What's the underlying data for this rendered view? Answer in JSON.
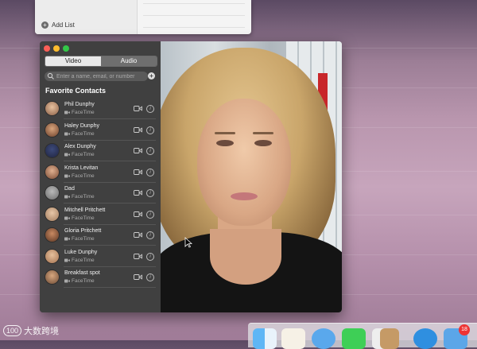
{
  "colors": {
    "close": "#fc5f57",
    "minimize": "#fdbc2e",
    "zoom": "#33c748",
    "panel_bg": "#404040"
  },
  "reminders": {
    "add_list_label": "Add List"
  },
  "facetime": {
    "tabs": {
      "video_label": "Video",
      "audio_label": "Audio",
      "selected": "Video"
    },
    "search": {
      "placeholder": "Enter a name, email, or number"
    },
    "favorites_title": "Favorite Contacts",
    "contacts": [
      {
        "name": "Phil Dunphy",
        "service": "FaceTime"
      },
      {
        "name": "Haley Dunphy",
        "service": "FaceTime"
      },
      {
        "name": "Alex Dunphy",
        "service": "FaceTime"
      },
      {
        "name": "Krista Levitan",
        "service": "FaceTime"
      },
      {
        "name": "Dad",
        "service": "FaceTime"
      },
      {
        "name": "Mitchell Pritchett",
        "service": "FaceTime"
      },
      {
        "name": "Gloria Pritchett",
        "service": "FaceTime"
      },
      {
        "name": "Luke Dunphy",
        "service": "FaceTime"
      },
      {
        "name": "Breakfast spot",
        "service": "FaceTime"
      }
    ]
  },
  "dock": {
    "badge_count": "18",
    "icons": [
      "finder-icon",
      "contacts-icon",
      "safari-icon",
      "facetime-icon",
      "notes-icon",
      "calendar-icon",
      "safari-compass-icon",
      "mail-icon"
    ]
  },
  "watermark": {
    "text": "大数跨境",
    "logo_text": "100"
  }
}
